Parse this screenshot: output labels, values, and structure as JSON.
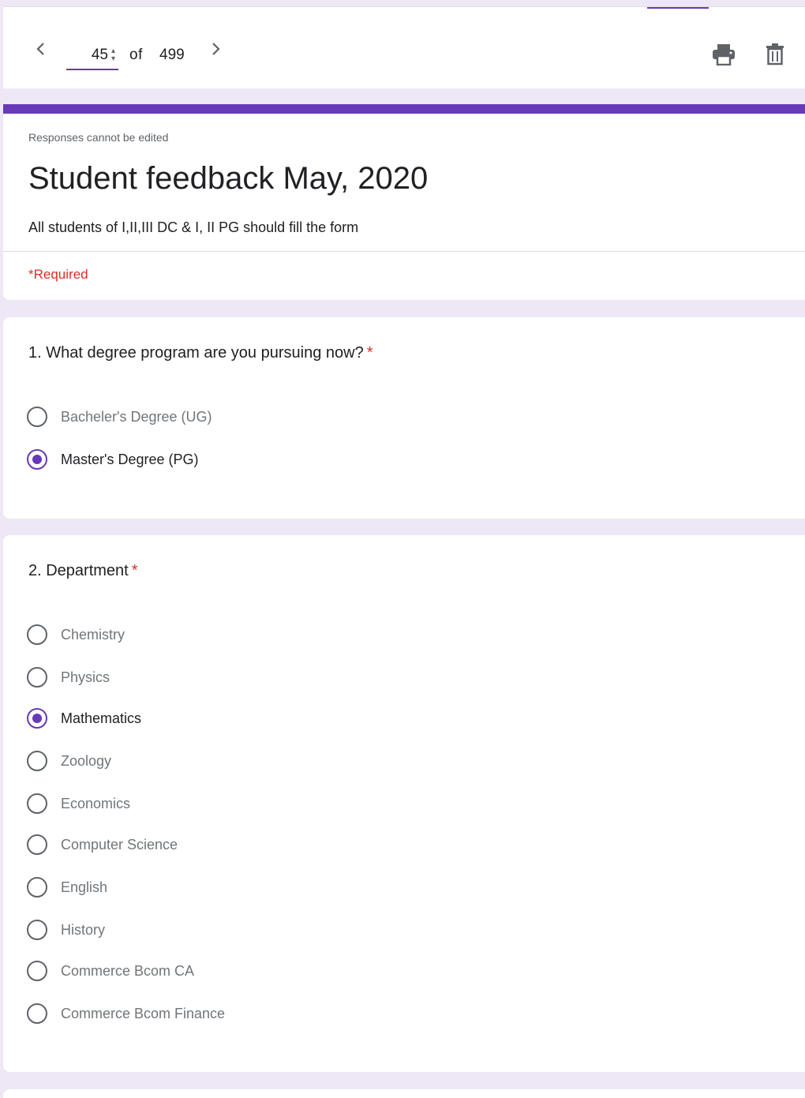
{
  "navigator": {
    "current": "45",
    "of_label": "of",
    "total": "499"
  },
  "header": {
    "note": "Responses cannot be edited",
    "title": "Student feedback May, 2020",
    "description": "All students of I,II,III DC & I, II PG should fill the form",
    "required_note": "*Required"
  },
  "questions": [
    {
      "title": "1. What degree program are you pursuing now?",
      "required_mark": "*",
      "selected": "Master's Degree (PG)",
      "options": [
        "Bacheler's Degree (UG)",
        "Master's Degree (PG)"
      ]
    },
    {
      "title": "2. Department",
      "required_mark": "*",
      "selected": "Mathematics",
      "options": [
        "Chemistry",
        "Physics",
        "Mathematics",
        "Zoology",
        "Economics",
        "Computer Science",
        "English",
        "History",
        "Commerce Bcom CA",
        "Commerce Bcom Finance"
      ]
    }
  ],
  "colors": {
    "accent": "#673ab7",
    "background": "#ede7f6",
    "required": "#d93025"
  }
}
